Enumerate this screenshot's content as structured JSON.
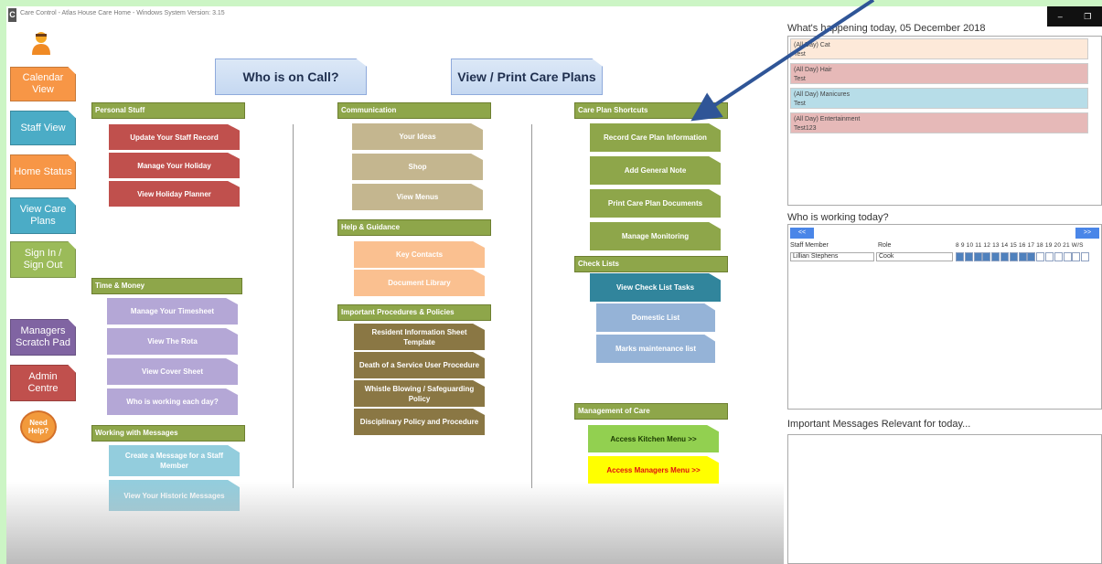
{
  "window": {
    "title": "Care Control - Atlas House Care Home - Windows System Version: 3.15"
  },
  "sidebar": {
    "items": [
      {
        "label": "Calendar View",
        "color": "#f79646"
      },
      {
        "label": "Staff View",
        "color": "#4bacc6"
      },
      {
        "label": "Home Status",
        "color": "#f79646"
      },
      {
        "label": "View Care Plans",
        "color": "#4bacc6"
      },
      {
        "label": "Sign In / Sign Out",
        "color": "#9bbb59"
      },
      {
        "label": "Managers Scratch Pad",
        "color": "#8064a2"
      },
      {
        "label": "Admin Centre",
        "color": "#c0504d"
      }
    ],
    "help": "Need Help?"
  },
  "top_buttons": {
    "on_call": "Who is on Call?",
    "care_plans": "View / Print Care Plans"
  },
  "sections": {
    "personal": {
      "title": "Personal Stuff",
      "items": [
        "Update Your Staff Record",
        "Manage Your Holiday",
        "View Holiday Planner"
      ]
    },
    "time_money": {
      "title": "Time & Money",
      "items": [
        "Manage Your Timesheet",
        "View The Rota",
        "View Cover Sheet",
        "Who is working each day?"
      ]
    },
    "messages": {
      "title": "Working with Messages",
      "items": [
        "Create a Message for a Staff Member",
        "View Your Historic Messages"
      ]
    },
    "communication": {
      "title": "Communication",
      "items": [
        "Your Ideas",
        "Shop",
        "View Menus"
      ]
    },
    "help_guidance": {
      "title": "Help & Guidance",
      "items": [
        "Key Contacts",
        "Document Library"
      ]
    },
    "procedures": {
      "title": "Important Procedures & Policies",
      "items": [
        "Resident Information Sheet Template",
        "Death of a Service User Procedure",
        "Whistle Blowing / Safeguarding Policy",
        "Disciplinary Policy and Procedure"
      ]
    },
    "care_plan_shortcuts": {
      "title": "Care Plan Shortcuts",
      "items": [
        "Record Care Plan Information",
        "Add General Note",
        "Print Care Plan Documents",
        "Manage Monitoring"
      ]
    },
    "check_lists": {
      "title": "Check Lists",
      "items": [
        "View Check List Tasks",
        "Domestic List",
        "Marks maintenance list"
      ]
    },
    "management": {
      "title": "Management of Care",
      "items": [
        "Access Kitchen Menu >>",
        "Access Managers Menu >>"
      ]
    }
  },
  "today": {
    "title": "What's happening today, 05 December 2018",
    "events": [
      {
        "time": "(All Day) Cat",
        "desc": "Test",
        "color": "#fde9d9"
      },
      {
        "time": "(All Day) Hair",
        "desc": "Test",
        "color": "#e6b9b8"
      },
      {
        "time": "(All Day) Manicures",
        "desc": "Test",
        "color": "#b7dde8"
      },
      {
        "time": "(All Day) Entertainment",
        "desc": "Test123",
        "color": "#e6b9b8"
      }
    ]
  },
  "working": {
    "title": "Who is working today?",
    "prev": "<<",
    "next": ">>",
    "col_staff": "Staff Member",
    "col_role": "Role",
    "hours": "8  9  10 11 12 13 14 15 16 17 18 19 20 21 W/S",
    "rows": [
      {
        "name": "Lillian Stephens",
        "role": "Cook",
        "filled_slots": 9,
        "total_slots": 15
      }
    ]
  },
  "messages_panel": {
    "title": "Important Messages Relevant for today..."
  }
}
